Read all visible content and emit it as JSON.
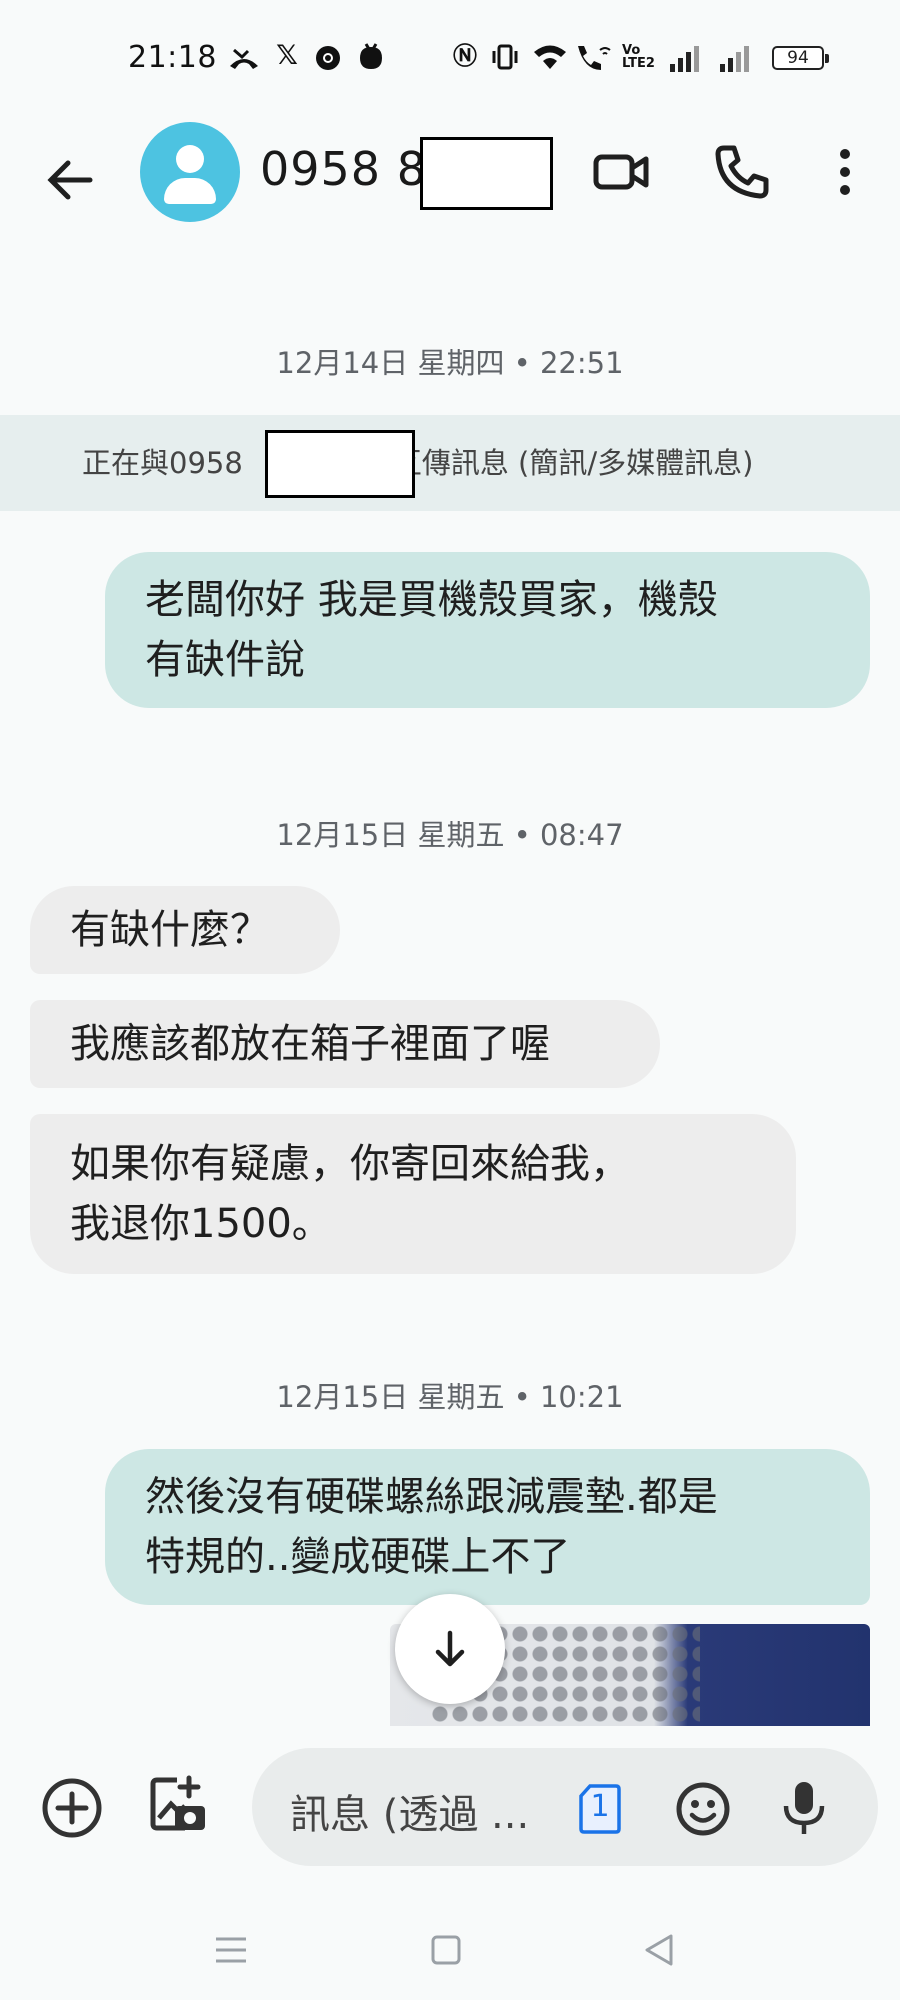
{
  "status_bar": {
    "time": "21:18",
    "battery": "94"
  },
  "header": {
    "contact_name": "0958 8",
    "back_icon": "arrow-left-icon",
    "avatar_icon": "person-icon",
    "video_icon": "video-camera-icon",
    "phone_icon": "phone-icon",
    "more_icon": "more-vert-icon"
  },
  "conversation": {
    "info_prefix": "正在與0958",
    "info_suffix": "互傳訊息 (簡訊/多媒體訊息)",
    "groups": [
      {
        "date": "12月14日 星期四 • 22:51",
        "messages": [
          {
            "direction": "outgoing",
            "lines": [
              "老闆你好 我是買機殼買家，機殼",
              "有缺件說"
            ]
          }
        ]
      },
      {
        "date": "12月15日 星期五 • 08:47",
        "messages": [
          {
            "direction": "incoming",
            "lines": [
              "有缺什麼？"
            ]
          },
          {
            "direction": "incoming",
            "lines": [
              "我應該都放在箱子裡面了喔"
            ]
          },
          {
            "direction": "incoming",
            "lines": [
              "如果你有疑慮，你寄回來給我，",
              "我退你1500。"
            ]
          }
        ]
      },
      {
        "date": "12月15日 星期五 • 10:21",
        "messages": [
          {
            "direction": "outgoing",
            "lines": [
              "然後沒有硬碟螺絲跟減震墊.都是",
              "特規的..變成硬碟上不了"
            ]
          }
        ]
      }
    ]
  },
  "compose": {
    "placeholder": "訊息 (透過 ...",
    "sim_label": "1",
    "add_icon": "add-circle-icon",
    "gallery_icon": "gallery-add-icon",
    "emoji_icon": "emoji-icon",
    "mic_icon": "mic-icon",
    "scroll_icon": "arrow-down-icon"
  },
  "colors": {
    "outgoing_bubble": "#cde7e4",
    "incoming_bubble": "#ededed",
    "avatar": "#4dc3e1",
    "background": "#f8fafa"
  }
}
